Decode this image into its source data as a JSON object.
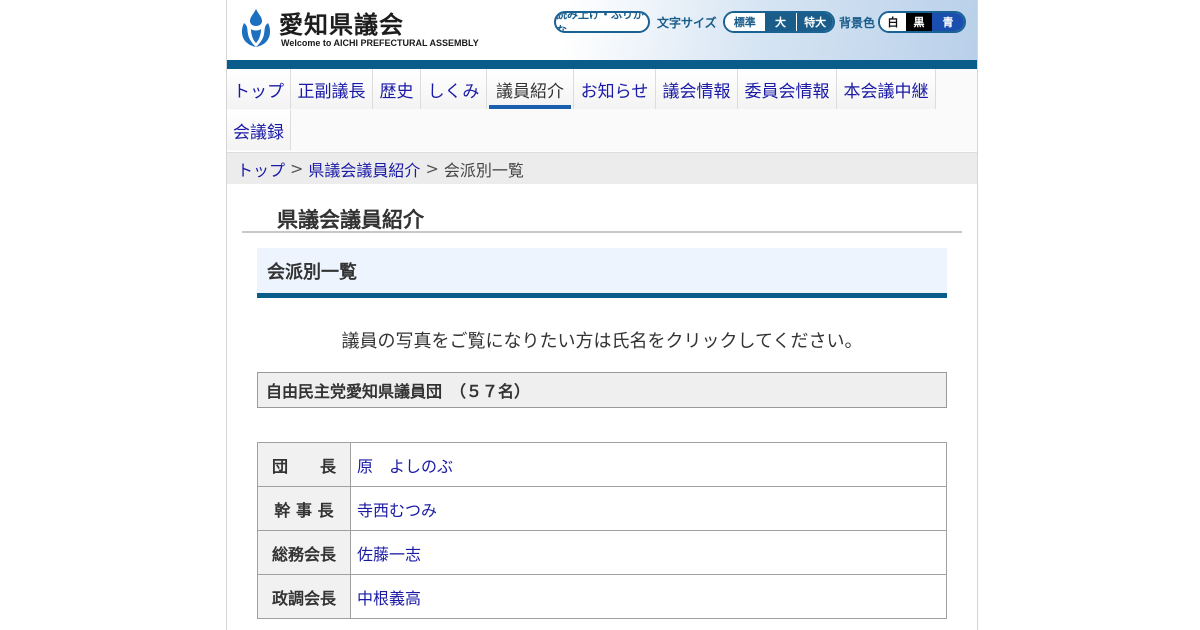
{
  "header": {
    "title": "愛知県議会",
    "subtitle": "Welcome to AICHI PREFECTURAL ASSEMBLY",
    "furigana_button": "読み上げ・ふりがな",
    "font_size_label": "文字サイズ",
    "font_sizes": [
      "標準",
      "大",
      "特大"
    ],
    "bg_color_label": "背景色",
    "bg_colors": [
      "白",
      "黒",
      "青"
    ]
  },
  "nav": {
    "items": [
      "トップ",
      "正副議長",
      "歴史",
      "しくみ",
      "議員紹介",
      "お知らせ",
      "議会情報",
      "委員会情報",
      "本会議中継",
      "会議録"
    ],
    "active": "議員紹介"
  },
  "breadcrumb": {
    "items": [
      "トップ",
      "県議会議員紹介",
      "会派別一覧"
    ],
    "separator": ">"
  },
  "page": {
    "title": "県議会議員紹介",
    "section_title": "会派別一覧",
    "instruction": "議員の写真をご覧になりたい方は氏名をクリックしてください。"
  },
  "faction": {
    "heading": "自由民主党愛知県議員団　（５７名）",
    "officers": [
      {
        "role": "団　　長",
        "name": "原　よしのぶ"
      },
      {
        "role": "幹 事 長",
        "name": "寺西むつみ"
      },
      {
        "role": "総務会長",
        "name": "佐藤一志"
      },
      {
        "role": "政調会長",
        "name": "中根義高"
      }
    ]
  },
  "colors": {
    "accent": "#0a5c8a",
    "link": "#1a1aa6",
    "nav_active_bar": "#1a5fae"
  }
}
